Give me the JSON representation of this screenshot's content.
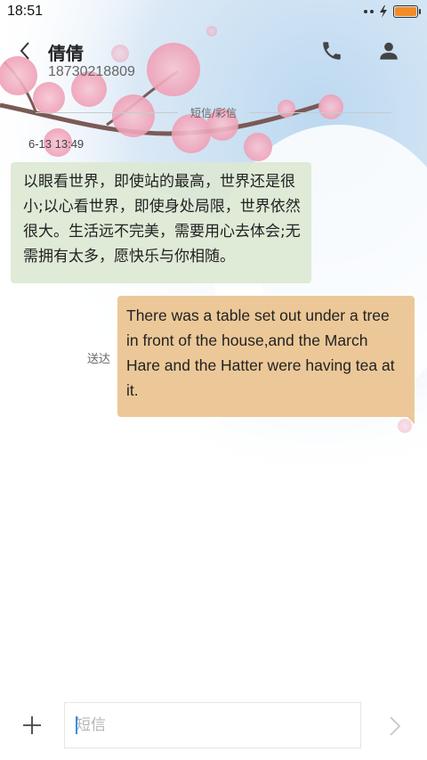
{
  "status_bar": {
    "time": "18:51",
    "battery_color": "#f28c28"
  },
  "header": {
    "contact_name": "倩倩",
    "phone_number": "18730218809",
    "back_icon": "chevron-left-icon",
    "call_icon": "phone-icon",
    "contact_icon": "person-icon"
  },
  "thread": {
    "divider_label": "短信/彩信",
    "timestamp": "6-13 13:49",
    "incoming": {
      "text": "以眼看世界，即使站的最高，世界还是很小;以心看世界，即使身处局限，世界依然很大。生活远不完美，需要用心去体会;无需拥有太多，愿快乐与你相随。",
      "bg_color": "#dce8d4"
    },
    "outgoing": {
      "text": "There was a table set out under a tree in front of the house,and the March Hare and the Hatter were having tea at it.",
      "status": "送达",
      "bg_color": "#ecc898"
    }
  },
  "composer": {
    "placeholder": "短信",
    "value": "",
    "plus_icon": "plus-icon",
    "send_icon": "chevron-right-icon"
  }
}
